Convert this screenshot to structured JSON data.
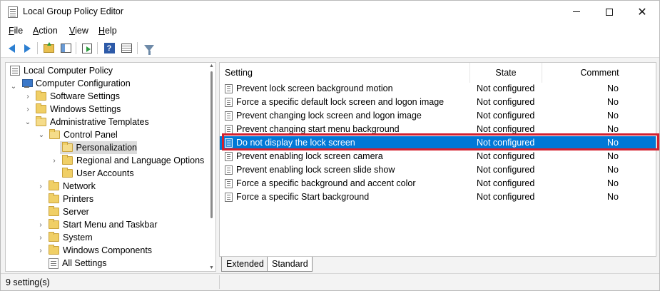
{
  "window": {
    "title": "Local Group Policy Editor",
    "close_glyph": "✕"
  },
  "menu": {
    "items": [
      {
        "key": "F",
        "rest": "ile"
      },
      {
        "key": "A",
        "rest": "ction"
      },
      {
        "key": "V",
        "rest": "iew"
      },
      {
        "key": "H",
        "rest": "elp"
      }
    ]
  },
  "toolbar": {
    "help_glyph": "?"
  },
  "tree": {
    "chev_open": "⌄",
    "chev_closed": "›",
    "items": [
      {
        "label": "Local Computer Policy",
        "icon": "policy-root-icon"
      },
      {
        "label": "Computer Configuration",
        "icon": "computer-icon"
      },
      {
        "label": "Software Settings",
        "icon": "folder-icon"
      },
      {
        "label": "Windows Settings",
        "icon": "folder-icon"
      },
      {
        "label": "Administrative Templates",
        "icon": "folder-icon"
      },
      {
        "label": "Control Panel",
        "icon": "folder-icon"
      },
      {
        "label": "Personalization",
        "icon": "folder-icon",
        "selected": true
      },
      {
        "label": "Regional and Language Options",
        "icon": "folder-icon"
      },
      {
        "label": "User Accounts",
        "icon": "folder-icon"
      },
      {
        "label": "Network",
        "icon": "folder-icon"
      },
      {
        "label": "Printers",
        "icon": "folder-icon"
      },
      {
        "label": "Server",
        "icon": "folder-icon"
      },
      {
        "label": "Start Menu and Taskbar",
        "icon": "folder-icon"
      },
      {
        "label": "System",
        "icon": "folder-icon"
      },
      {
        "label": "Windows Components",
        "icon": "folder-icon"
      },
      {
        "label": "All Settings",
        "icon": "all-settings-icon"
      }
    ]
  },
  "list": {
    "columns": {
      "setting": "Setting",
      "state": "State",
      "comment": "Comment"
    },
    "rows": [
      {
        "setting": "Prevent lock screen background motion",
        "state": "Not configured",
        "comment": "No"
      },
      {
        "setting": "Force a specific default lock screen and logon image",
        "state": "Not configured",
        "comment": "No"
      },
      {
        "setting": "Prevent changing lock screen and logon image",
        "state": "Not configured",
        "comment": "No"
      },
      {
        "setting": "Prevent changing start menu background",
        "state": "Not configured",
        "comment": "No"
      },
      {
        "setting": "Do not display the lock screen",
        "state": "Not configured",
        "comment": "No",
        "selected": true
      },
      {
        "setting": "Prevent enabling lock screen camera",
        "state": "Not configured",
        "comment": "No"
      },
      {
        "setting": "Prevent enabling lock screen slide show",
        "state": "Not configured",
        "comment": "No"
      },
      {
        "setting": "Force a specific background and accent color",
        "state": "Not configured",
        "comment": "No"
      },
      {
        "setting": "Force a specific Start background",
        "state": "Not configured",
        "comment": "No"
      }
    ]
  },
  "tabs": {
    "extended": "Extended",
    "standard": "Standard"
  },
  "status": {
    "text": "9 setting(s)"
  },
  "colors": {
    "selection": "#0078d7",
    "highlight_border": "#d4202f"
  }
}
